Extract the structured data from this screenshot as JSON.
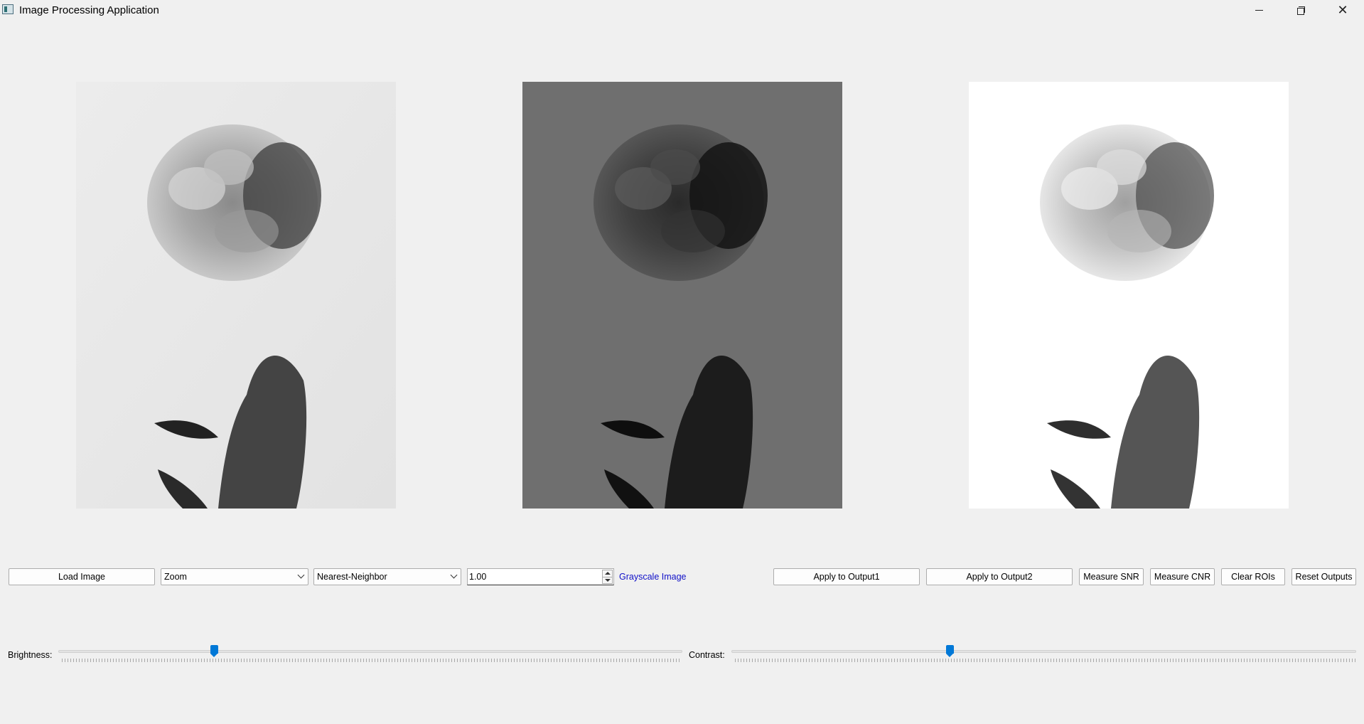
{
  "window": {
    "title": "Image Processing Application",
    "icon": "app-window-icon",
    "controls": {
      "minimize": "minimize-icon",
      "maximize": "restore-icon",
      "close": "close-icon",
      "close_glyph": "✕"
    }
  },
  "panels": {
    "input": {
      "name": "input-image",
      "tone": "light-gray background, peony flower held in hand"
    },
    "output1": {
      "name": "output1-image",
      "tone": "dark-gray background, peony flower held in hand"
    },
    "output2": {
      "name": "output2-image",
      "tone": "white background, peony flower held in hand"
    }
  },
  "toolbar": {
    "load_label": "Load Image",
    "operation_select": {
      "value": "Zoom"
    },
    "interpolation_select": {
      "value": "Nearest-Neighbor"
    },
    "factor_value": "1.00",
    "mode_label": "Grayscale Image",
    "apply_output1_label": "Apply to Output1",
    "apply_output2_label": "Apply to Output2",
    "measure_snr_label": "Measure SNR",
    "measure_cnr_label": "Measure CNR",
    "clear_rois_label": "Clear ROIs",
    "reset_outputs_label": "Reset Outputs"
  },
  "sliders": {
    "brightness": {
      "label": "Brightness:",
      "value_fraction": 0.25
    },
    "contrast": {
      "label": "Contrast:",
      "value_fraction": 0.35
    }
  },
  "colors": {
    "accent": "#0078d7",
    "link": "#1010c8",
    "window_bg": "#f0f0f0"
  }
}
